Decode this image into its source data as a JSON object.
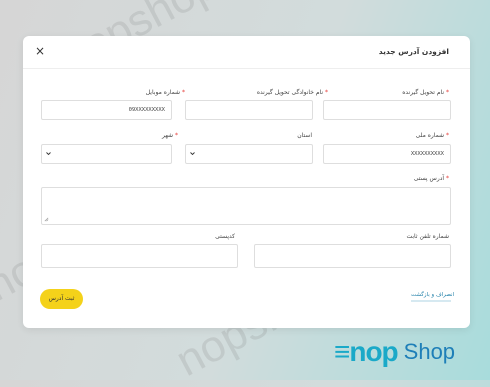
{
  "watermark": "nopshop",
  "modal": {
    "title": "افزودن آدرس جدید",
    "close_label": "×"
  },
  "fields": {
    "recipient_name": {
      "label": "نام تحویل گیرنده",
      "value": ""
    },
    "recipient_family": {
      "label": "نام خانوادگی تحویل گیرنده",
      "value": ""
    },
    "phone": {
      "label": "شماره موبایل",
      "value": "09XXXXXXXXX"
    },
    "national_code": {
      "label": "شماره ملی",
      "value": "XXXXXXXXXX"
    },
    "province": {
      "label": "استان",
      "value": ""
    },
    "city": {
      "label": "شهر",
      "value": ""
    },
    "address": {
      "label": "آدرس پستی",
      "value": ""
    },
    "landline": {
      "label": "شماره تلفن ثابت",
      "value": ""
    },
    "postal_code": {
      "label": "کدپستی",
      "value": ""
    }
  },
  "actions": {
    "save_label": "ثبت آدرس",
    "back_label": "انصراف و بازگشت"
  },
  "brand": {
    "mark": "≡nop",
    "name": "Shop",
    "color": "#1aa9c8"
  },
  "colors": {
    "accent": "#f4d21a",
    "required": "#e53935",
    "link": "#1f7fa8"
  }
}
